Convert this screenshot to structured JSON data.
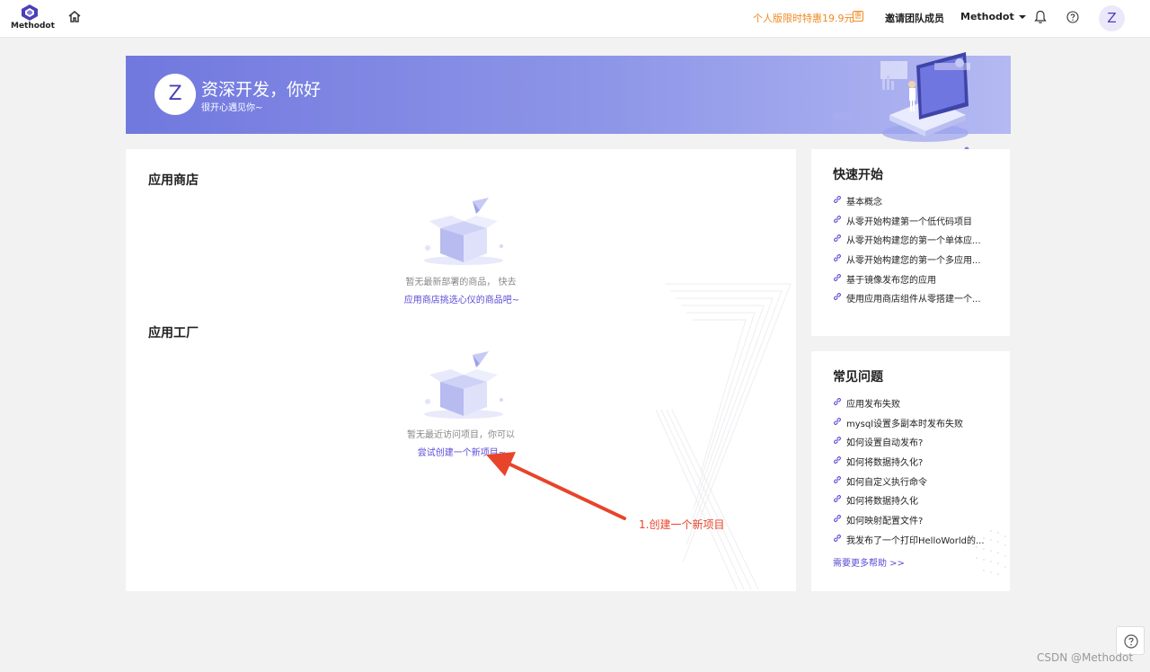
{
  "header": {
    "logo_text": "Methodot",
    "home_icon": "home-icon",
    "promo": "个人版限时特惠19.9元",
    "promo_badge": "惠",
    "invite": "邀请团队成员",
    "user_menu": "Methodot",
    "bell_icon": "bell-icon",
    "help_icon": "help-icon",
    "avatar_letter": "Z"
  },
  "banner": {
    "avatar_letter": "Z",
    "title": "资深开发，你好",
    "subtitle": "很开心遇见你~"
  },
  "main": {
    "app_store": {
      "title": "应用商店",
      "empty_text": "暂无最新部署的商品， 快去",
      "empty_link": "应用商店挑选心仪的商品吧~"
    },
    "app_factory": {
      "title": "应用工厂",
      "empty_text": "暂无最近访问项目，你可以",
      "empty_link": "尝试创建一个新项目~"
    }
  },
  "quick_start": {
    "title": "快速开始",
    "items": [
      "基本概念",
      "从零开始构建第一个低代码项目",
      "从零开始构建您的第一个单体应...",
      "从零开始构建您的第一个多应用...",
      "基于镜像发布您的应用",
      "使用应用商店组件从零搭建一个..."
    ]
  },
  "faq": {
    "title": "常见问题",
    "items": [
      "应用发布失败",
      "mysql设置多副本时发布失败",
      "如何设置自动发布?",
      "如何将数据持久化?",
      "如何自定义执行命令",
      "如何将数据持久化",
      "如何映射配置文件?",
      "我发布了一个打印HelloWorld的..."
    ],
    "more": "需要更多帮助 >>"
  },
  "annotation": {
    "text": "1.创建一个新项目",
    "color": "#e8442a"
  },
  "watermark": "CSDN @Methodot",
  "colors": {
    "accent": "#5b4bd6",
    "promo": "#f08a24",
    "banner_start": "#7178de",
    "banner_end": "#b4b9f2"
  }
}
